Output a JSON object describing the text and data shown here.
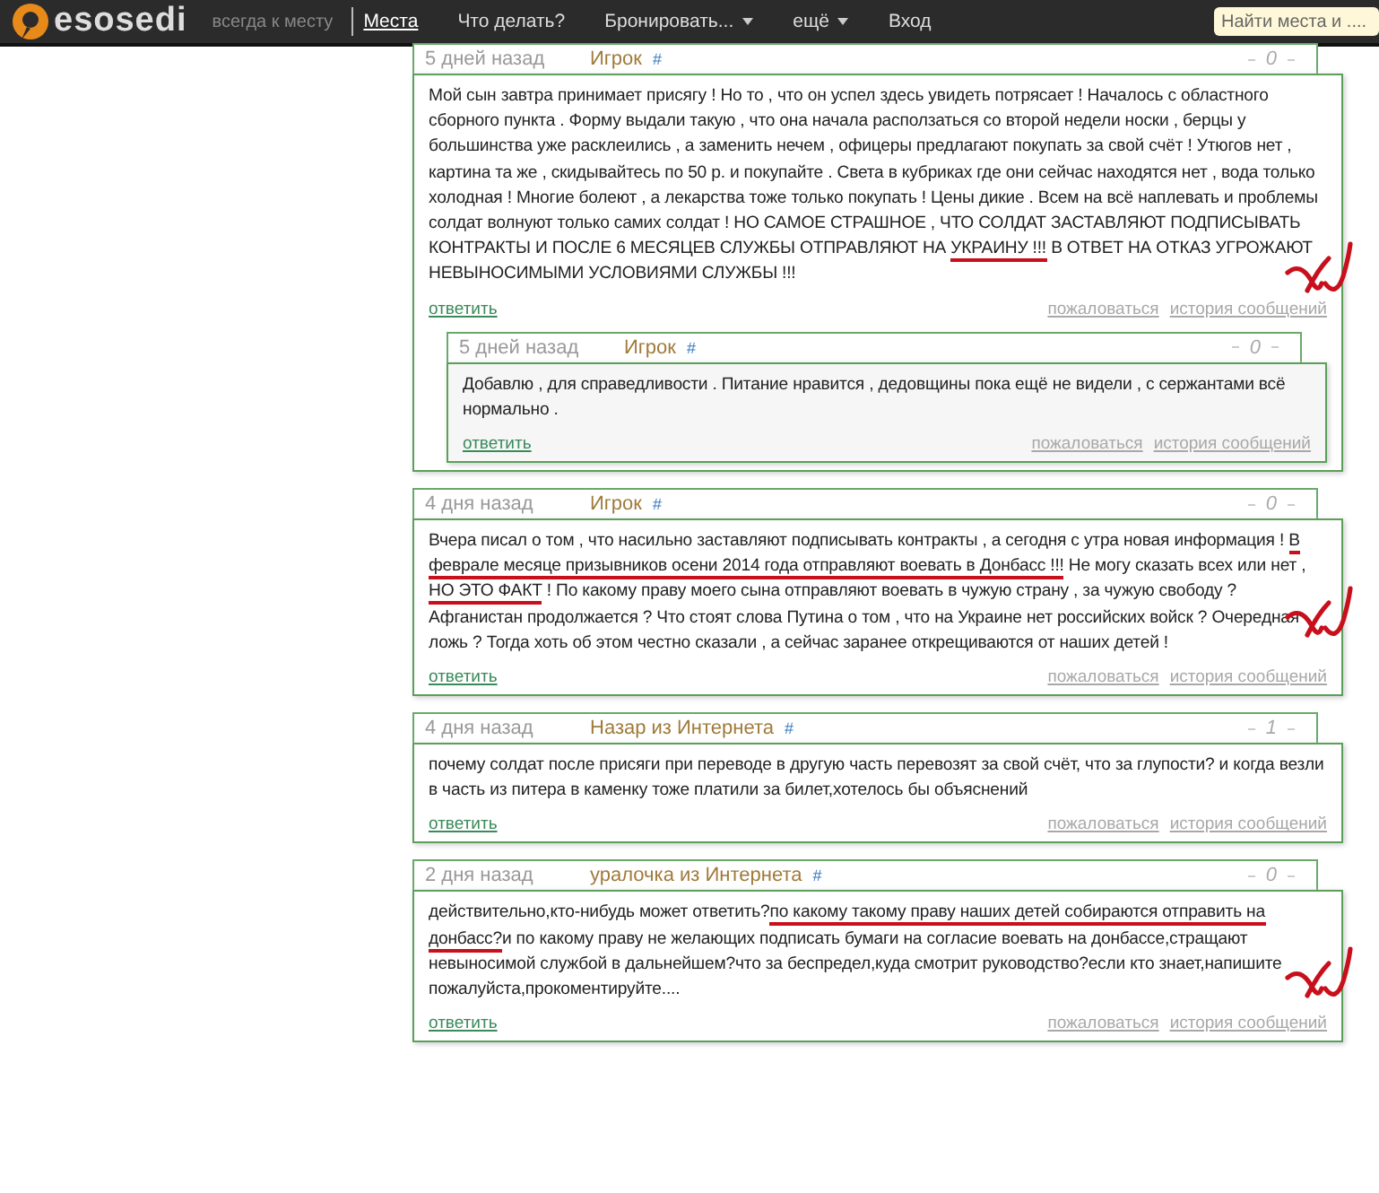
{
  "topbar": {
    "logo": "esosedi",
    "tagline": "всегда к месту",
    "nav": [
      {
        "label": "Места",
        "selected": true,
        "dropdown": false
      },
      {
        "label": "Что делать?",
        "selected": false,
        "dropdown": false
      },
      {
        "label": "Бронировать...",
        "selected": false,
        "dropdown": true
      },
      {
        "label": "ещё",
        "selected": false,
        "dropdown": true
      },
      {
        "label": "Вход",
        "selected": false,
        "dropdown": false
      }
    ],
    "search": {
      "placeholder": "Найти места и ...."
    }
  },
  "posts": [
    {
      "time": "5 дней назад",
      "author": "Игрок",
      "anchor": "#",
      "score": "0",
      "scribble": true,
      "body": [
        {
          "text": "Мой сын завтра принимает присягу ! Но то , что он успел здесь увидеть потрясает ! Началось с областного сборного пункта . Форму выдали такую , что она начала расползаться со второй недели носки , берцы у большинства уже расклеились , а заменить нечем , офицеры предлагают покупать за свой счёт ! Утюгов нет , картина та же , скидывайтесь по 50 р. и покупайте . Света в кубриках где они сейчас находятся нет , вода только холодная ! Многие болеют , а лекарства тоже только покупать ! Цены дикие . Всем на всё наплевать и проблемы солдат волнуют только самих солдат ! НО САМОЕ СТРАШНОЕ , ЧТО СОЛДАТ ЗАСТАВЛЯЮТ ПОДПИСЫВАТЬ КОНТРАКТЫ И ПОСЛЕ 6 МЕСЯЦЕВ СЛУЖБЫ ОТПРАВЛЯЮТ НА ",
          "underlined": false
        },
        {
          "text": "УКРАИНУ !!!",
          "underlined": true
        },
        {
          "text": " В ОТВЕТ НА ОТКАЗ УГРОЖАЮТ НЕВЫНОСИМЫМИ УСЛОВИЯМИ СЛУЖБЫ !!!",
          "underlined": false
        }
      ],
      "reply": "ответить",
      "report": "пожаловаться",
      "history": "история сообщений",
      "children": [
        {
          "time": "5 дней назад",
          "author": "Игрок",
          "anchor": "#",
          "score": "0",
          "scribble": false,
          "body": [
            {
              "text": "Добавлю , для справедливости . Питание нравится , дедовщины пока ещё не видели , с сержантами всё нормально .",
              "underlined": false
            }
          ],
          "reply": "ответить",
          "report": "пожаловаться",
          "history": "история сообщений"
        }
      ]
    },
    {
      "time": "4 дня назад",
      "author": "Игрок",
      "anchor": "#",
      "score": "0",
      "scribble": true,
      "body": [
        {
          "text": "Вчера писал о том , что насильно заставляют подписывать контракты , а сегодня с утра новая информация ! ",
          "underlined": false
        },
        {
          "text": "В феврале месяце призывников осени 2014 года отправляют воевать в Донбасс !!!",
          "underlined": true
        },
        {
          "text": " Не могу сказать всех или нет , ",
          "underlined": false
        },
        {
          "text": "НО ЭТО ФАКТ",
          "underlined": true
        },
        {
          "text": " ! По какому праву моего сына отправляют воевать в чужую страну , за чужую свободу ? Афганистан продолжается ? Что стоят слова Путина о том , что на Украине нет российских войск ? Очередная ложь ? Тогда хоть об этом честно сказали , а сейчас заранее открещиваются от наших детей !",
          "underlined": false
        }
      ],
      "reply": "ответить",
      "report": "пожаловаться",
      "history": "история сообщений"
    },
    {
      "time": "4 дня назад",
      "author": "Назар из Интернета",
      "anchor": "#",
      "score": "1",
      "scribble": false,
      "body": [
        {
          "text": "почему солдат после присяги при переводе в другую часть перевозят за свой счёт, что за глупости? и когда везли в часть из питера в каменку тоже платили за билет,хотелось бы объяснений",
          "underlined": false
        }
      ],
      "reply": "ответить",
      "report": "пожаловаться",
      "history": "история сообщений"
    },
    {
      "time": "2 дня назад",
      "author": "уралочка из Интернета",
      "anchor": "#",
      "score": "0",
      "scribble": true,
      "body": [
        {
          "text": "действительно,кто-нибудь может ответить?",
          "underlined": false
        },
        {
          "text": "по какому такому праву наших детей собираются отправить на донбасс?",
          "underlined": true
        },
        {
          "text": "и по какому праву не желающих подписать бумаги на согласие воевать на донбассе,стращают невыносимой службой в дальнейшем?что за беспредел,куда смотрит руководство?если кто знает,напишите пожалуйста,прокоментируйте....",
          "underlined": false
        }
      ],
      "reply": "ответить",
      "report": "пожаловаться",
      "history": "история сообщений"
    }
  ]
}
